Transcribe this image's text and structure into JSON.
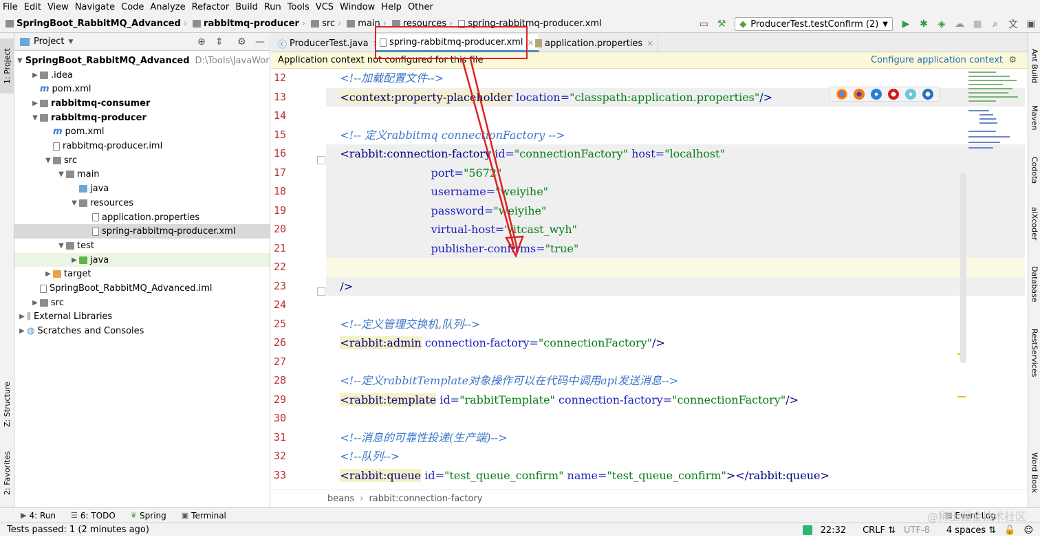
{
  "menu": [
    "File",
    "Edit",
    "View",
    "Navigate",
    "Code",
    "Analyze",
    "Refactor",
    "Build",
    "Run",
    "Tools",
    "VCS",
    "Window",
    "Help",
    "Other"
  ],
  "navbar": {
    "crumbs": [
      "SpringBoot_RabbitMQ_Advanced",
      "rabbitmq-producer",
      "src",
      "main",
      "resources",
      "spring-rabbitmq-producer.xml"
    ]
  },
  "run_config": "ProducerTest.testConfirm (2)",
  "left_tools": {
    "project": "1: Project",
    "structure": "Z: Structure",
    "favorites": "2: Favorites"
  },
  "project_panel": {
    "title": "Project",
    "tree": [
      {
        "label": "SpringBoot_RabbitMQ_Advanced",
        "extra": "D:\\Tools\\JavaWorkSpa",
        "depth": 0,
        "arrow": "down",
        "bold": true,
        "icon": "folder"
      },
      {
        "label": ".idea",
        "depth": 1,
        "arrow": "right",
        "icon": "folder"
      },
      {
        "label": "pom.xml",
        "depth": 1,
        "arrow": "",
        "icon": "maven"
      },
      {
        "label": "rabbitmq-consumer",
        "depth": 1,
        "arrow": "right",
        "bold": true,
        "icon": "folder"
      },
      {
        "label": "rabbitmq-producer",
        "depth": 1,
        "arrow": "down",
        "bold": true,
        "icon": "folder"
      },
      {
        "label": "pom.xml",
        "depth": 2,
        "arrow": "",
        "icon": "maven"
      },
      {
        "label": "rabbitmq-producer.iml",
        "depth": 2,
        "arrow": "",
        "icon": "file"
      },
      {
        "label": "src",
        "depth": 2,
        "arrow": "down",
        "icon": "folder"
      },
      {
        "label": "main",
        "depth": 3,
        "arrow": "down",
        "icon": "folder"
      },
      {
        "label": "java",
        "depth": 4,
        "arrow": "",
        "icon": "blue"
      },
      {
        "label": "resources",
        "depth": 4,
        "arrow": "down",
        "icon": "folder"
      },
      {
        "label": "application.properties",
        "depth": 5,
        "arrow": "",
        "icon": "file"
      },
      {
        "label": "spring-rabbitmq-producer.xml",
        "depth": 5,
        "arrow": "",
        "icon": "file",
        "selected": true
      },
      {
        "label": "test",
        "depth": 3,
        "arrow": "down",
        "icon": "folder"
      },
      {
        "label": "java",
        "depth": 4,
        "arrow": "right",
        "icon": "green",
        "highlight": true
      },
      {
        "label": "target",
        "depth": 2,
        "arrow": "right",
        "icon": "orange"
      },
      {
        "label": "SpringBoot_RabbitMQ_Advanced.iml",
        "depth": 1,
        "arrow": "",
        "icon": "file"
      },
      {
        "label": "src",
        "depth": 1,
        "arrow": "right",
        "icon": "folder"
      },
      {
        "label": "External Libraries",
        "depth": 0,
        "arrow": "right",
        "icon": "lib"
      },
      {
        "label": "Scratches and Consoles",
        "depth": 0,
        "arrow": "right",
        "icon": "scratch"
      }
    ]
  },
  "editor": {
    "tabs": [
      {
        "label": "ProducerTest.java",
        "active": false
      },
      {
        "label": "spring-rabbitmq-producer.xml",
        "active": true
      },
      {
        "label": "application.properties",
        "active": false
      }
    ],
    "banner": "Application context not configured for this file",
    "banner_link": "Configure application context",
    "line_numbers": [
      "12",
      "13",
      "14",
      "15",
      "16",
      "17",
      "18",
      "19",
      "20",
      "21",
      "22",
      "23",
      "24",
      "25",
      "26",
      "27",
      "28",
      "29",
      "30",
      "31",
      "32",
      "33"
    ],
    "code": {
      "l12": "<!--加载配置文件-->",
      "l13_tag": "<context:property-placeholder",
      "l13_attr": " location=",
      "l13_val": "\"classpath:application.properties\"",
      "l13_end": "/>",
      "l15": "<!-- 定义rabbitmq connectionFactory -->",
      "l16_tag": "<rabbit:connection-factory",
      "l16_a1": " id=",
      "l16_v1": "\"connectionFactory\"",
      "l16_a2": " host=",
      "l16_v2": "\"localhost\"",
      "l17_a": "port=",
      "l17_v": "\"5672\"",
      "l18_a": "username=",
      "l18_v": "\"weiyihe\"",
      "l19_a": "password=",
      "l19_v": "\"weiyihe\"",
      "l20_a": "virtual-host=",
      "l20_v": "\"/itcast_wyh\"",
      "l21_a": "publisher-confirms=",
      "l21_v": "\"true\"",
      "l23": "/>",
      "l25": "<!--定义管理交换机,队列-->",
      "l26_tag": "<rabbit:admin",
      "l26_a": " connection-factory=",
      "l26_v": "\"connectionFactory\"",
      "l26_end": "/>",
      "l28": "<!--定义rabbitTemplate对象操作可以在代码中调用api发送消息-->",
      "l29_tag": "<rabbit:template",
      "l29_a1": " id=",
      "l29_v1": "\"rabbitTemplate\"",
      "l29_a2": " connection-factory=",
      "l29_v2": "\"connectionFactory\"",
      "l29_end": "/>",
      "l31": "<!--消息的可靠性投递(生产端)-->",
      "l32": "<!--队列-->",
      "l33_tag": "<rabbit:queue",
      "l33_a1": " id=",
      "l33_v1": "\"test_queue_confirm\"",
      "l33_a2": " name=",
      "l33_v2": "\"test_queue_confirm\"",
      "l33_end": "></rabbit:queue>"
    },
    "bottom_breadcrumb": [
      "beans",
      "rabbit:connection-factory"
    ]
  },
  "right_tools": [
    "Ant Build",
    "Maven",
    "Codota",
    "aiXcoder",
    "Database",
    "RestServices",
    "Word Book"
  ],
  "bottom_tabs": [
    {
      "label": "4: Run"
    },
    {
      "label": "6: TODO"
    },
    {
      "label": "Spring"
    },
    {
      "label": "Terminal"
    }
  ],
  "event_log": "Event Log",
  "status": {
    "message": "Tests passed: 1 (2 minutes ago)",
    "position": "22:32",
    "line_sep": "CRLF",
    "encoding": "UTF-8",
    "indent": "4 spaces"
  },
  "watermark": "@稀土掘金技术社区",
  "colors": {
    "accent": "#4a88c7",
    "highlight_box": "#e02020",
    "arrow": "#e02020",
    "banner_bg": "#fbf7d9"
  }
}
